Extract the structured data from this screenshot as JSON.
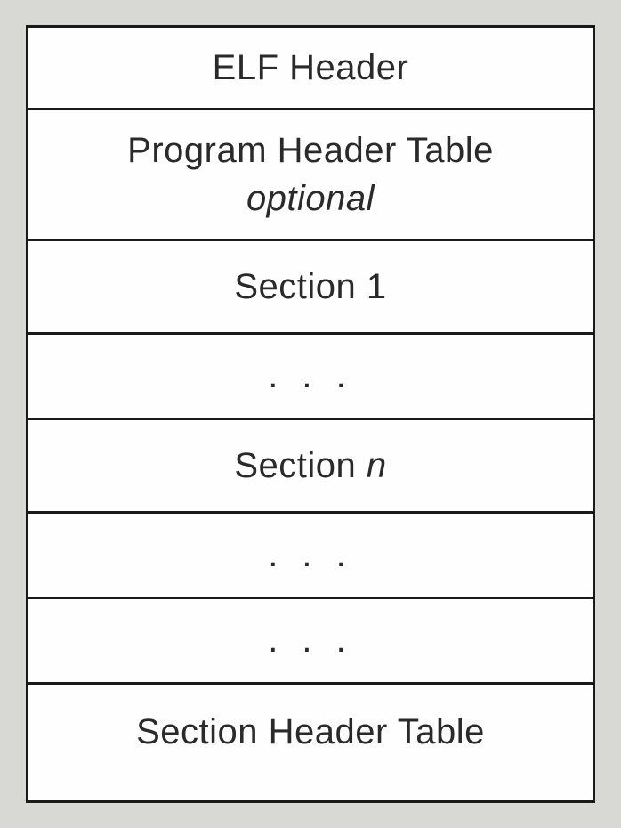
{
  "rows": {
    "elf_header": "ELF Header",
    "program_header_table": "Program Header Table",
    "program_header_optional": "optional",
    "section_1": "Section 1",
    "ellipsis_1": ". . .",
    "section_n_prefix": "Section ",
    "section_n_var": "n",
    "ellipsis_2": ". . .",
    "ellipsis_3": ". . .",
    "section_header_table": "Section Header Table"
  }
}
